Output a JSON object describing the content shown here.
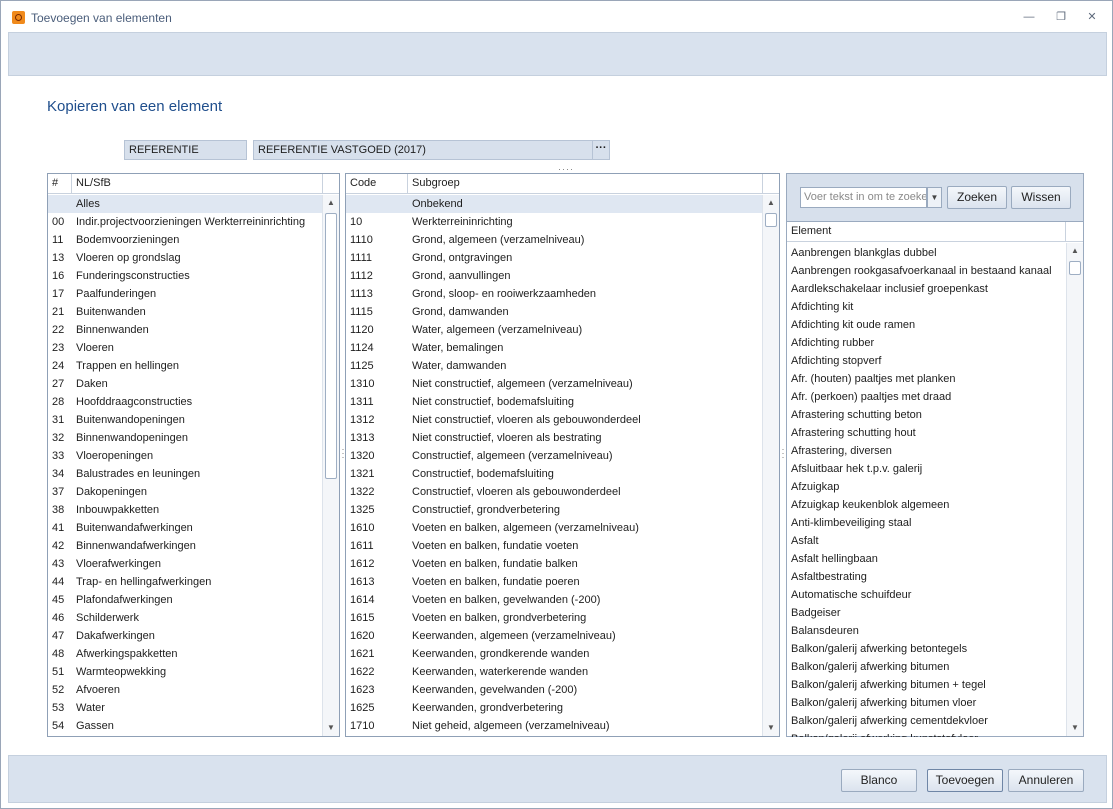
{
  "window": {
    "title": "Toevoegen van elementen",
    "controls": [
      "minimize",
      "restore",
      "close"
    ]
  },
  "heading": "Kopieren van een element",
  "reference": {
    "field1": "REFERENTIE",
    "field2": "REFERENTIE VASTGOED (2017)",
    "browse_label": "···"
  },
  "left_grid": {
    "headers": [
      "#",
      "NL/SfB"
    ],
    "rows": [
      [
        "",
        "Alles"
      ],
      [
        "00",
        "Indir.projectvoorzieningen Werkterreininrichting"
      ],
      [
        "11",
        "Bodemvoorzieningen"
      ],
      [
        "13",
        "Vloeren op grondslag"
      ],
      [
        "16",
        "Funderingsconstructies"
      ],
      [
        "17",
        "Paalfunderingen"
      ],
      [
        "21",
        "Buitenwanden"
      ],
      [
        "22",
        "Binnenwanden"
      ],
      [
        "23",
        "Vloeren"
      ],
      [
        "24",
        "Trappen en hellingen"
      ],
      [
        "27",
        "Daken"
      ],
      [
        "28",
        "Hoofddraagconstructies"
      ],
      [
        "31",
        "Buitenwandopeningen"
      ],
      [
        "32",
        "Binnenwandopeningen"
      ],
      [
        "33",
        "Vloeropeningen"
      ],
      [
        "34",
        "Balustrades en leuningen"
      ],
      [
        "37",
        "Dakopeningen"
      ],
      [
        "38",
        "Inbouwpakketten"
      ],
      [
        "41",
        "Buitenwandafwerkingen"
      ],
      [
        "42",
        "Binnenwandafwerkingen"
      ],
      [
        "43",
        "Vloerafwerkingen"
      ],
      [
        "44",
        "Trap- en hellingafwerkingen"
      ],
      [
        "45",
        "Plafondafwerkingen"
      ],
      [
        "46",
        "Schilderwerk"
      ],
      [
        "47",
        "Dakafwerkingen"
      ],
      [
        "48",
        "Afwerkingspakketten"
      ],
      [
        "51",
        "Warmteopwekking"
      ],
      [
        "52",
        "Afvoeren"
      ],
      [
        "53",
        "Water"
      ],
      [
        "54",
        "Gassen"
      ]
    ]
  },
  "middle_grid": {
    "headers": [
      "Code",
      "Subgroep"
    ],
    "rows": [
      [
        "",
        "Onbekend"
      ],
      [
        "10",
        "Werkterreininrichting"
      ],
      [
        "1110",
        "Grond, algemeen (verzamelniveau)"
      ],
      [
        "1111",
        "Grond, ontgravingen"
      ],
      [
        "1112",
        "Grond, aanvullingen"
      ],
      [
        "1113",
        "Grond, sloop- en rooiwerkzaamheden"
      ],
      [
        "1115",
        "Grond, damwanden"
      ],
      [
        "1120",
        "Water, algemeen (verzamelniveau)"
      ],
      [
        "1124",
        "Water, bemalingen"
      ],
      [
        "1125",
        "Water, damwanden"
      ],
      [
        "1310",
        "Niet constructief, algemeen (verzamelniveau)"
      ],
      [
        "1311",
        "Niet constructief, bodemafsluiting"
      ],
      [
        "1312",
        "Niet constructief, vloeren als gebouwonderdeel"
      ],
      [
        "1313",
        "Niet constructief, vloeren als bestrating"
      ],
      [
        "1320",
        "Constructief, algemeen (verzamelniveau)"
      ],
      [
        "1321",
        "Constructief, bodemafsluiting"
      ],
      [
        "1322",
        "Constructief, vloeren als gebouwonderdeel"
      ],
      [
        "1325",
        "Constructief, grondverbetering"
      ],
      [
        "1610",
        "Voeten en balken, algemeen (verzamelniveau)"
      ],
      [
        "1611",
        "Voeten en balken, fundatie voeten"
      ],
      [
        "1612",
        "Voeten en balken, fundatie balken"
      ],
      [
        "1613",
        "Voeten en balken, fundatie poeren"
      ],
      [
        "1614",
        "Voeten en balken, gevelwanden (-200)"
      ],
      [
        "1615",
        "Voeten en balken, grondverbetering"
      ],
      [
        "1620",
        "Keerwanden, algemeen (verzamelniveau)"
      ],
      [
        "1621",
        "Keerwanden, grondkerende wanden"
      ],
      [
        "1622",
        "Keerwanden, waterkerende wanden"
      ],
      [
        "1623",
        "Keerwanden, gevelwanden (-200)"
      ],
      [
        "1625",
        "Keerwanden, grondverbetering"
      ],
      [
        "1710",
        "Niet geheid, algemeen (verzamelniveau)"
      ]
    ]
  },
  "search": {
    "placeholder": "Voer tekst in om te zoeken",
    "search_label": "Zoeken",
    "clear_label": "Wissen"
  },
  "element_grid": {
    "header": "Element",
    "rows": [
      "Aanbrengen blankglas dubbel",
      "Aanbrengen rookgasafvoerkanaal in bestaand kanaal",
      "Aardlekschakelaar inclusief groepenkast",
      "Afdichting kit",
      "Afdichting kit oude ramen",
      "Afdichting rubber",
      "Afdichting stopverf",
      "Afr. (houten) paaltjes met planken",
      "Afr. (perkoen) paaltjes met draad",
      "Afrastering schutting beton",
      "Afrastering schutting hout",
      "Afrastering, diversen",
      "Afsluitbaar hek t.p.v. galerij",
      "Afzuigkap",
      "Afzuigkap keukenblok algemeen",
      "Anti-klimbeveiliging staal",
      "Asfalt",
      "Asfalt hellingbaan",
      "Asfaltbestrating",
      "Automatische schuifdeur",
      "Badgeiser",
      "Balansdeuren",
      "Balkon/galerij afwerking betontegels",
      "Balkon/galerij afwerking bitumen",
      "Balkon/galerij afwerking bitumen + tegel",
      "Balkon/galerij afwerking bitumen vloer",
      "Balkon/galerij afwerking cementdekvloer",
      "Balkon/galerij afwerking kunststofvloer"
    ]
  },
  "footer": {
    "blanco": "Blanco",
    "toevoegen": "Toevoegen",
    "annuleren": "Annuleren"
  },
  "colors": {
    "heading": "#1f4e8c",
    "band": "#d9e2ee",
    "selected_row": "#dfe7f2",
    "accent_icon": "#f08a1c"
  }
}
